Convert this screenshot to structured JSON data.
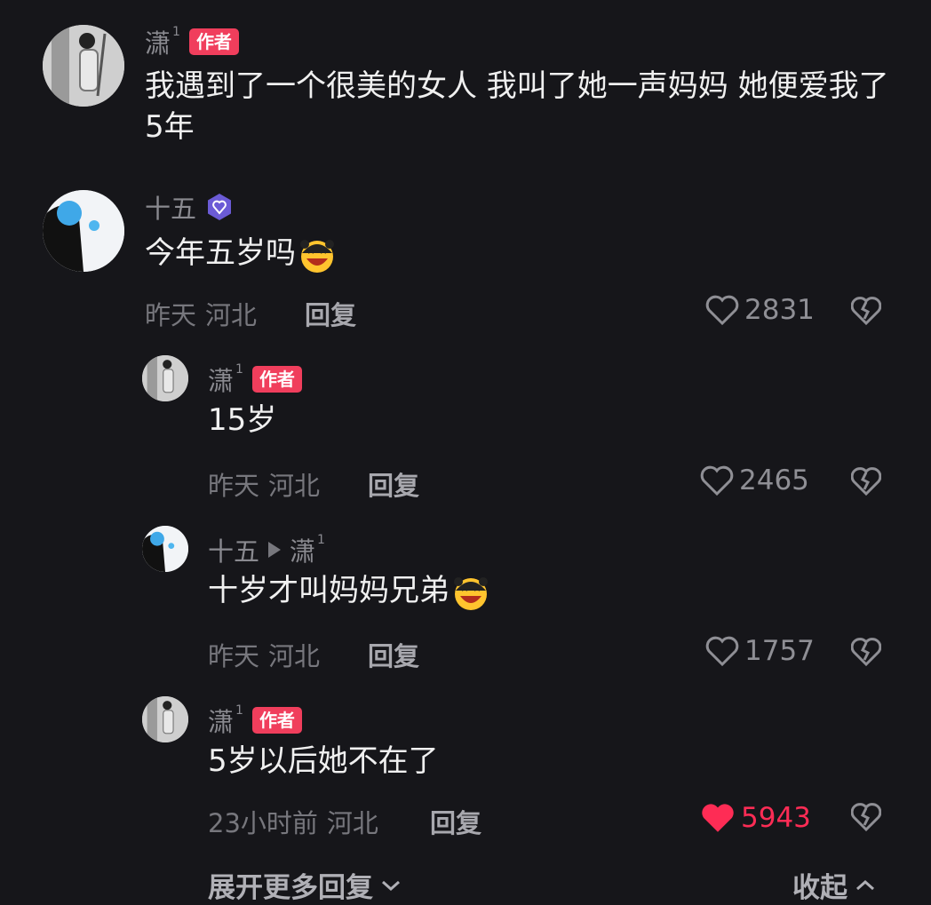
{
  "colors": {
    "background": "#16161a",
    "author_badge": "#f03e5c",
    "like_active": "#fe2c55",
    "muted": "#77777d"
  },
  "post": {
    "author": "潇",
    "author_sup": "1",
    "badge": "作者",
    "text": "我遇到了一个很美的女人 我叫了她一声妈妈 她便爱我了5年"
  },
  "comments": [
    {
      "user": "十五",
      "icon": "level-badge-icon",
      "text": "今年五岁吗",
      "emoji": "laughing-emoji",
      "time": "昨天",
      "location": "河北",
      "reply_label": "回复",
      "likes": "2831",
      "liked": false
    },
    {
      "user": "潇",
      "user_sup": "1",
      "badge": "作者",
      "text": "15岁",
      "time": "昨天",
      "location": "河北",
      "reply_label": "回复",
      "likes": "2465",
      "liked": false
    },
    {
      "user": "十五",
      "reply_to": "潇",
      "reply_to_sup": "1",
      "text": "十岁才叫妈妈兄弟",
      "emoji": "laughing-emoji",
      "time": "昨天",
      "location": "河北",
      "reply_label": "回复",
      "likes": "1757",
      "liked": false
    },
    {
      "user": "潇",
      "user_sup": "1",
      "badge": "作者",
      "text": "5岁以后她不在了",
      "time": "23小时前",
      "location": "河北",
      "reply_label": "回复",
      "likes": "5943",
      "liked": true
    }
  ],
  "footer": {
    "expand_label": "展开更多回复",
    "collapse_label": "收起"
  }
}
